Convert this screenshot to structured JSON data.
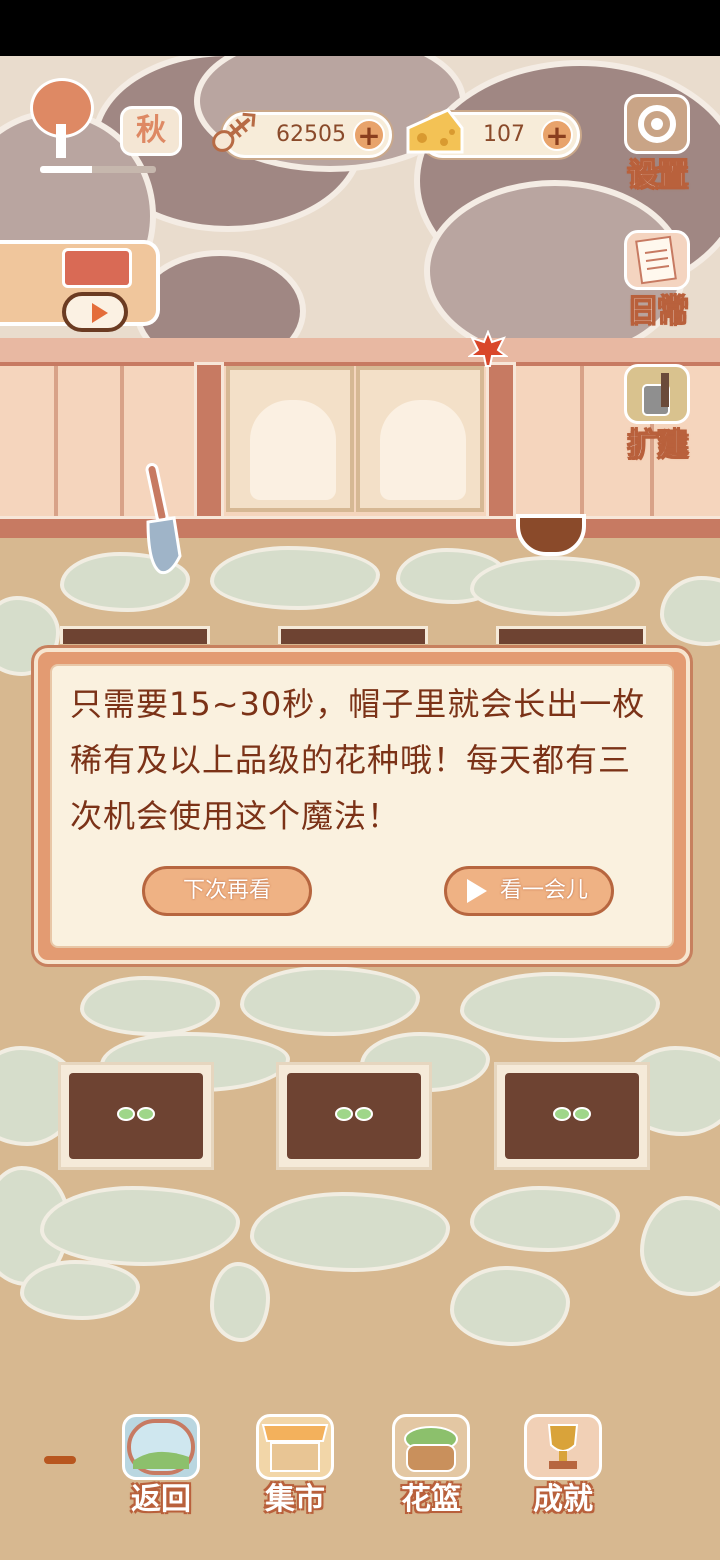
{
  "hud": {
    "season_label": "秋",
    "season_progress": 0.45,
    "fishbone_count": "62505",
    "cheese_count": "107",
    "add_symbol": "+"
  },
  "side_menu": {
    "settings_label": "设置",
    "daily_label": "日常",
    "expand_label": "扩建"
  },
  "dialog": {
    "message": "只需要15~30秒，帽子里就会长出一枚稀有及以上品级的花种哦！每天都有三次机会使用这个魔法！",
    "later_button": "下次再看",
    "watch_button": "看一会儿"
  },
  "bottom_nav": {
    "back_label": "返回",
    "market_label": "集市",
    "basket_label": "花篮",
    "achievements_label": "成就"
  },
  "colors": {
    "accent_orange": "#e39b72",
    "text_brown": "#7b3217",
    "sprout_green": "#9fd689"
  }
}
